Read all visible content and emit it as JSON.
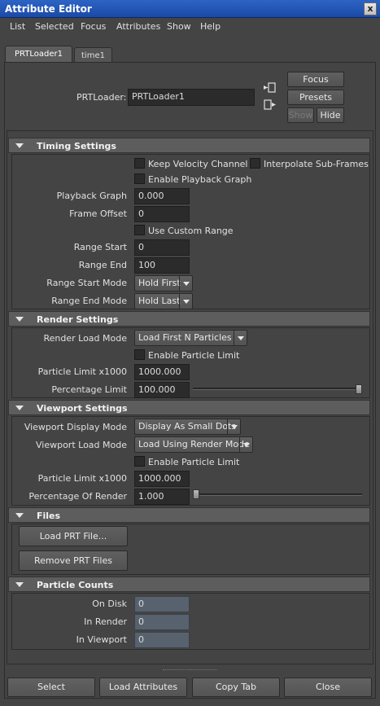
{
  "window": {
    "title": "Attribute Editor",
    "close_glyph": "x"
  },
  "menus": [
    "List",
    "Selected",
    "Focus",
    "Attributes",
    "Show",
    "Help"
  ],
  "tabs": [
    {
      "label": "PRTLoader1",
      "active": true
    },
    {
      "label": "time1",
      "active": false
    }
  ],
  "node": {
    "label": "PRTLoader:",
    "value": "PRTLoader1",
    "buttons": {
      "focus": "Focus",
      "presets": "Presets",
      "show": "Show",
      "hide": "Hide"
    },
    "icons": [
      "input-connection-icon",
      "output-connection-icon"
    ]
  },
  "timing": {
    "title": "Timing Settings",
    "keep_velocity": "Keep Velocity Channel",
    "interpolate": "Interpolate Sub-Frames",
    "enable_playback": "Enable Playback Graph",
    "playback_graph_label": "Playback Graph",
    "playback_graph_value": "0.000",
    "frame_offset_label": "Frame Offset",
    "frame_offset_value": "0",
    "use_custom_range": "Use Custom Range",
    "range_start_label": "Range Start",
    "range_start_value": "0",
    "range_end_label": "Range End",
    "range_end_value": "100",
    "range_start_mode_label": "Range Start Mode",
    "range_start_mode_value": "Hold First",
    "range_end_mode_label": "Range End Mode",
    "range_end_mode_value": "Hold Last"
  },
  "render": {
    "title": "Render Settings",
    "load_mode_label": "Render Load Mode",
    "load_mode_value": "Load First N Particles",
    "enable_limit": "Enable Particle Limit",
    "limit_label": "Particle Limit x1000",
    "limit_value": "1000.000",
    "pct_label": "Percentage Limit",
    "pct_value": "100.000",
    "pct_fraction": 1.0
  },
  "viewport": {
    "title": "Viewport Settings",
    "display_mode_label": "Viewport Display Mode",
    "display_mode_value": "Display As Small Dots",
    "load_mode_label": "Viewport Load Mode",
    "load_mode_value": "Load Using Render Mode",
    "enable_limit": "Enable Particle Limit",
    "limit_label": "Particle Limit x1000",
    "limit_value": "1000.000",
    "pct_label": "Percentage Of Render",
    "pct_value": "1.000",
    "pct_fraction": 0.0
  },
  "files": {
    "title": "Files",
    "load_btn": "Load PRT File...",
    "remove_btn": "Remove PRT Files"
  },
  "counts": {
    "title": "Particle Counts",
    "on_disk_label": "On Disk",
    "on_disk_value": "0",
    "in_render_label": "In Render",
    "in_render_value": "0",
    "in_viewport_label": "In Viewport",
    "in_viewport_value": "0"
  },
  "bottom": {
    "select": "Select",
    "load_attributes": "Load Attributes",
    "copy_tab": "Copy Tab",
    "close": "Close"
  },
  "colors": {
    "title_bar": "#1b4aa8",
    "background": "#444444",
    "field": "#2b2b2b",
    "readonly_field": "#58626e"
  }
}
